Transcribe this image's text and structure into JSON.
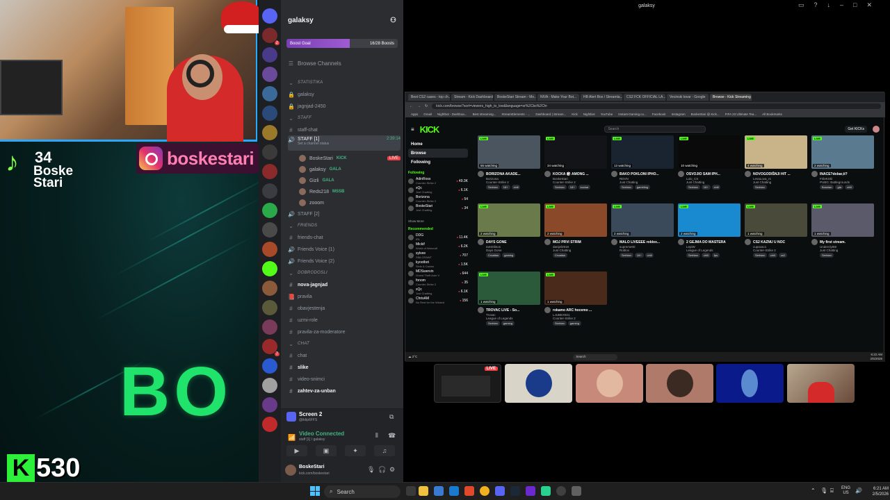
{
  "overlay": {
    "tiktok_count": "34",
    "tiktok_name": "Boske Stari",
    "instagram_handle": "boskestari",
    "big_text": "BO",
    "kick_count": "530",
    "kick_name": "boskestari"
  },
  "window": {
    "title": "galaksy"
  },
  "discord": {
    "server_name": "galaksy",
    "boost_label": "Boost Goal",
    "boost_count": "16/28 Boosts",
    "boost_progress": 0.57,
    "browse_channels": "Browse Channels",
    "rows": [
      {
        "type": "cat",
        "label": "STATISTIKA"
      },
      {
        "type": "ch",
        "icon": "🔒",
        "label": "galaksy"
      },
      {
        "type": "ch",
        "icon": "🔒",
        "label": "jagnjad-2450"
      },
      {
        "type": "cat",
        "label": "staff"
      },
      {
        "type": "ch",
        "icon": "#",
        "label": "staff-chat"
      },
      {
        "type": "voice-active",
        "icon": "🔊",
        "label": "STAFF [1]",
        "time": "2:39:14",
        "sub": "Set a channel status"
      },
      {
        "type": "member",
        "label": "BoskeStari",
        "pill": "KICK",
        "live": "LIVE"
      },
      {
        "type": "member",
        "label": "galaksy",
        "pill": "GALA"
      },
      {
        "type": "member",
        "label": "Gizli",
        "pill": "GALA"
      },
      {
        "type": "member",
        "label": "Reds218",
        "pill": "MSSB"
      },
      {
        "type": "member",
        "label": "zooom"
      },
      {
        "type": "ch",
        "icon": "🔊",
        "label": "STAFF [2]"
      },
      {
        "type": "cat",
        "label": "FRIENDS"
      },
      {
        "type": "ch",
        "icon": "#",
        "label": "friends-chat"
      },
      {
        "type": "ch",
        "icon": "🔊",
        "label": "Friends Voice (1)"
      },
      {
        "type": "ch",
        "icon": "🔊",
        "label": "Friends Voice (2)"
      },
      {
        "type": "cat",
        "label": "DOBRODOSLI"
      },
      {
        "type": "ch-bold",
        "icon": "#",
        "label": "nova-jagnjad"
      },
      {
        "type": "ch",
        "icon": "📕",
        "label": "pravila"
      },
      {
        "type": "ch",
        "icon": "#",
        "label": "obavjestenja"
      },
      {
        "type": "ch",
        "icon": "#",
        "label": "uzmi-role"
      },
      {
        "type": "ch",
        "icon": "#",
        "label": "pravila-za-moderatore"
      },
      {
        "type": "cat",
        "label": "CHAT"
      },
      {
        "type": "ch",
        "icon": "#",
        "label": "chat"
      },
      {
        "type": "ch-bold",
        "icon": "#",
        "label": "slike"
      },
      {
        "type": "ch",
        "icon": "#",
        "label": "video-snimci"
      },
      {
        "type": "ch-bold",
        "icon": "#",
        "label": "zahtev-za-unban"
      }
    ],
    "stream_title": "Screen 2",
    "stream_sub": "@ildip6FFS",
    "voice_status": "Video Connected",
    "voice_channel": "staff [1] / galaksy",
    "user_name": "BoskeStari",
    "user_status": "kick.com/boskestari"
  },
  "browser": {
    "tabs": [
      "Best CS2 cases - top ch...",
      "Stream - Kick Dashboard",
      "BoskeStari Stream - Mo...",
      "NIVA - Make Your Bot...",
      "HB Alert Box / Streamla...",
      "CS2 FCK OFFICIAL LA...",
      "Vecinski tovar - Google",
      "Browse - Kick Streaming"
    ],
    "url": "kick.com/browse?sort=viewers_high_to_low&language=sr%2Cbs%2Chr",
    "bookmarks": [
      "Apps",
      "Gmail",
      "Nightbot - Dashboa...",
      "Best streaming...",
      "StreamElements - ...",
      "Dashboard | Stream...",
      "Kick",
      "Nightbot",
      "YouTube",
      "Instant-Gaming.co...",
      "Facebook",
      "Instagram",
      "BoskeStari @ Kick...",
      "FIFA 23 Ultimate Tea...",
      "All Bookmarks"
    ],
    "kick_logo": "KICK",
    "search_placeholder": "Search",
    "get_kicks": "Get KICKs",
    "nav": [
      "Home",
      "Browse",
      "Following"
    ],
    "following_head": "Following",
    "following": [
      {
        "name": "AdinRoss",
        "game": "Counter-Strike 2",
        "viewers": "49.3K"
      },
      {
        "name": "xQc",
        "game": "Just Chatting",
        "viewers": "6.1K"
      },
      {
        "name": "Borizona",
        "game": "Counter-Strike 2",
        "viewers": "54"
      },
      {
        "name": "BoskeStari",
        "game": "Just Chatting",
        "viewers": "34"
      }
    ],
    "show_more": "Show More",
    "recommended_head": "Recommended",
    "recommended": [
      {
        "name": "DDG",
        "game": "IRL",
        "viewers": "11.4K"
      },
      {
        "name": "Mickif",
        "game": "World of Warcraft",
        "viewers": "6.2K"
      },
      {
        "name": "sylvee",
        "game": "SIM-CRAWT",
        "viewers": "707"
      },
      {
        "name": "kyootbot",
        "game": "Slots & Casino",
        "viewers": "1.5K"
      },
      {
        "name": "MDSwervin",
        "game": "Grand Theft Auto V",
        "viewers": "644"
      },
      {
        "name": "fonom",
        "game": "Counter-Strike 2",
        "viewers": "35"
      },
      {
        "name": "xQc",
        "game": "Just Chatting",
        "viewers": "6.1K"
      },
      {
        "name": "ChrisAM",
        "game": "No Rest for the Wicked",
        "viewers": "156"
      }
    ],
    "cards": [
      {
        "title": "BORIZONA AKADE...",
        "user": "Borizona",
        "cat": "Counter-Strike 2",
        "watch": "55 watching",
        "tags": [
          "Serbian",
          "18+",
          "chill"
        ],
        "color": "#4a5560"
      },
      {
        "title": "KOCKA 🎲 AMONG ...",
        "user": "BoskeStari",
        "cat": "Counter-Strike 2",
        "watch": "34 watching",
        "tags": [
          "Serbian",
          "18+",
          "kockar"
        ],
        "color": "#121417"
      },
      {
        "title": "BAKO POKLONI IPHO...",
        "user": "RDVN",
        "cat": "Just Chatting",
        "watch": "13 watching",
        "tags": [
          "Serbian",
          "gambling"
        ],
        "color": "#1a2330"
      },
      {
        "title": "OSVOJIO SAM IPH...",
        "user": "Lulo_CS",
        "cat": "Just Chatting",
        "watch": "10 watching",
        "tags": [
          "Serbian",
          "18+",
          "chill"
        ],
        "color": "#0a0a0a"
      },
      {
        "title": "NOVOGODIŠNJI HIT ...",
        "user": "LevaLova_rs",
        "cat": "Just Chatting",
        "watch": "4 watching",
        "tags": [
          "Serbian"
        ],
        "color": "#c9b48a"
      },
      {
        "title": "INACE?dobar,ti?",
        "user": "FrileKSkl",
        "cat": "PUBG: Battlegrounds",
        "watch": "2 watching",
        "tags": [
          "Bosnian",
          "gta",
          "chill"
        ],
        "color": "#5a7a90"
      },
      {
        "title": "DAYS GONE",
        "user": "IamDilinos",
        "cat": "Days Gone",
        "watch": "2 watching",
        "tags": [
          "Croatian",
          "gaming"
        ],
        "color": "#6a7a4a"
      },
      {
        "title": "MOJ PRVI STRIM",
        "user": "danijel2918",
        "cat": "Just Chatting",
        "watch": "2 watching",
        "tags": [
          "Croatian"
        ],
        "color": "#8a4a2a"
      },
      {
        "title": "MALO LIVEEEE roblox...",
        "user": "supreme00",
        "cat": "Roblox",
        "watch": "2 watching",
        "tags": [
          "Serbian",
          "18+",
          "chill"
        ],
        "color": "#3a4a5a"
      },
      {
        "title": "2 GEJMA DO MASTERA",
        "user": "LepiW",
        "cat": "League of Legends",
        "watch": "2 watching",
        "tags": [
          "Serbian",
          "chill",
          "fps"
        ],
        "color": "#1a8ad0"
      },
      {
        "title": "CS2 KAZNU U NOC",
        "user": "cupavac1",
        "cat": "Counter-Strike 2",
        "watch": "1 watching",
        "tags": [
          "Serbian",
          "chill",
          "cs2"
        ],
        "color": "#4a4a3a"
      },
      {
        "title": "My first stream.",
        "user": "Underclyt69",
        "cat": "Just Chatting",
        "watch": "1 watching",
        "tags": [
          "Serbian"
        ],
        "color": "#5a5a6a"
      },
      {
        "title": "TROVAC LIVE - So...",
        "user": "Trovac",
        "cat": "League of Legends",
        "watch": "1 watching",
        "tags": [
          "Serbian",
          "gaming"
        ],
        "color": "#2a5a3a"
      },
      {
        "title": "rokamo ARC hocemo ...",
        "user": "LJUBEX921",
        "cat": "Counter-Strike 2",
        "watch": "1 watching",
        "tags": [
          "Serbian",
          "gaming"
        ],
        "color": "#4a2a1a"
      }
    ],
    "inner_search": "Search",
    "inner_clock": "6:22 AM",
    "inner_date": "2/5/2026"
  },
  "participants": {
    "live_label": "LIVE"
  },
  "taskbar": {
    "search": "Search",
    "lang": "ENG",
    "region": "US",
    "time": "6:21 AM",
    "date": "2/5/2026"
  },
  "colors": {
    "kick_green": "#53fc18",
    "discord_bg": "#2b2d31",
    "live_red": "#f23f43"
  }
}
